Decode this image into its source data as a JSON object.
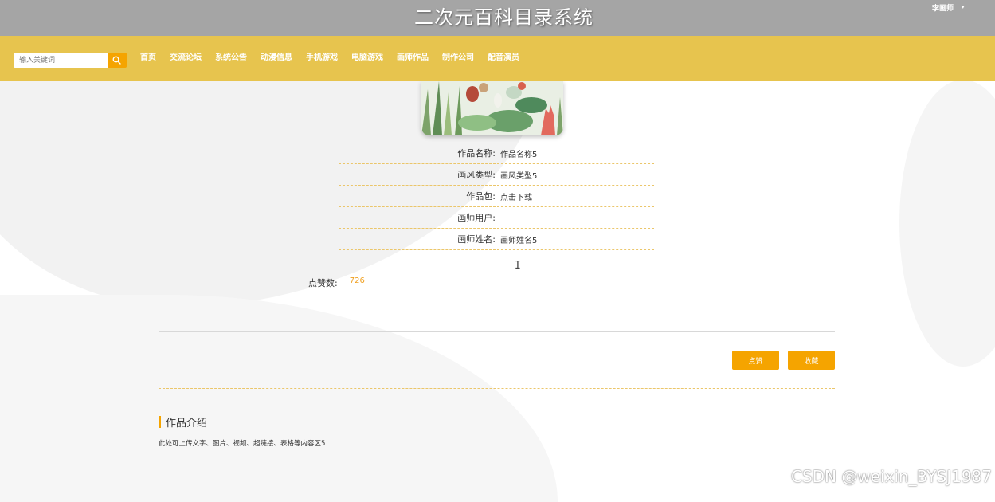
{
  "header": {
    "site_title": "二次元百科目录系统",
    "user_name": "李画师"
  },
  "search": {
    "placeholder": "输入关键词"
  },
  "nav": {
    "items": [
      "首页",
      "交流论坛",
      "系统公告",
      "动漫信息",
      "手机游戏",
      "电脑游戏",
      "画师作品",
      "制作公司",
      "配音演员"
    ]
  },
  "details": {
    "rows": [
      {
        "label": "作品名称:",
        "value": "作品名称5"
      },
      {
        "label": "画风类型:",
        "value": "画风类型5"
      },
      {
        "label": "作品包:",
        "value": "点击下载"
      },
      {
        "label": "画师用户:",
        "value": ""
      },
      {
        "label": "画师姓名:",
        "value": "画师姓名5"
      }
    ],
    "likes_label": "点赞数:",
    "likes_value": "726"
  },
  "actions": {
    "like_label": "点赞",
    "favorite_label": "收藏"
  },
  "intro": {
    "title": "作品介绍",
    "body": "此处可上传文字、图片、视频、超链接、表格等内容区5"
  },
  "watermark": "CSDN @weixin_BYSJ1987",
  "colors": {
    "topbar": "#a5a5a5",
    "navbar": "#e7c44e",
    "accent": "#f5a400",
    "dashed_line": "#ebc66a"
  },
  "icons": {
    "search": "search-icon",
    "dropdown": "chevron-down-icon"
  }
}
